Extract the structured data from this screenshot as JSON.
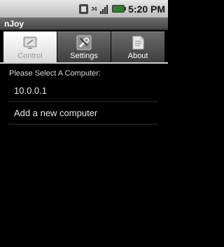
{
  "status_bar": {
    "network_label": "3G",
    "time": "5:20 PM"
  },
  "app": {
    "title": "nJoy"
  },
  "tabs": [
    {
      "label": "Control",
      "icon": "control-icon",
      "active": true
    },
    {
      "label": "Settings",
      "icon": "settings-icon",
      "active": false
    },
    {
      "label": "About",
      "icon": "about-icon",
      "active": false
    }
  ],
  "main": {
    "prompt": "Please Select A Computer:",
    "computers": [
      {
        "label": "10.0.0.1"
      },
      {
        "label": "Add a new computer"
      }
    ]
  },
  "colors": {
    "status_bar_bg": "#d0d0d0",
    "title_bar_bg": "#5a5a5a",
    "active_tab_bg": "#f0f0f0",
    "inactive_tab_bg": "#555555",
    "battery_green": "#2f7f2f"
  }
}
